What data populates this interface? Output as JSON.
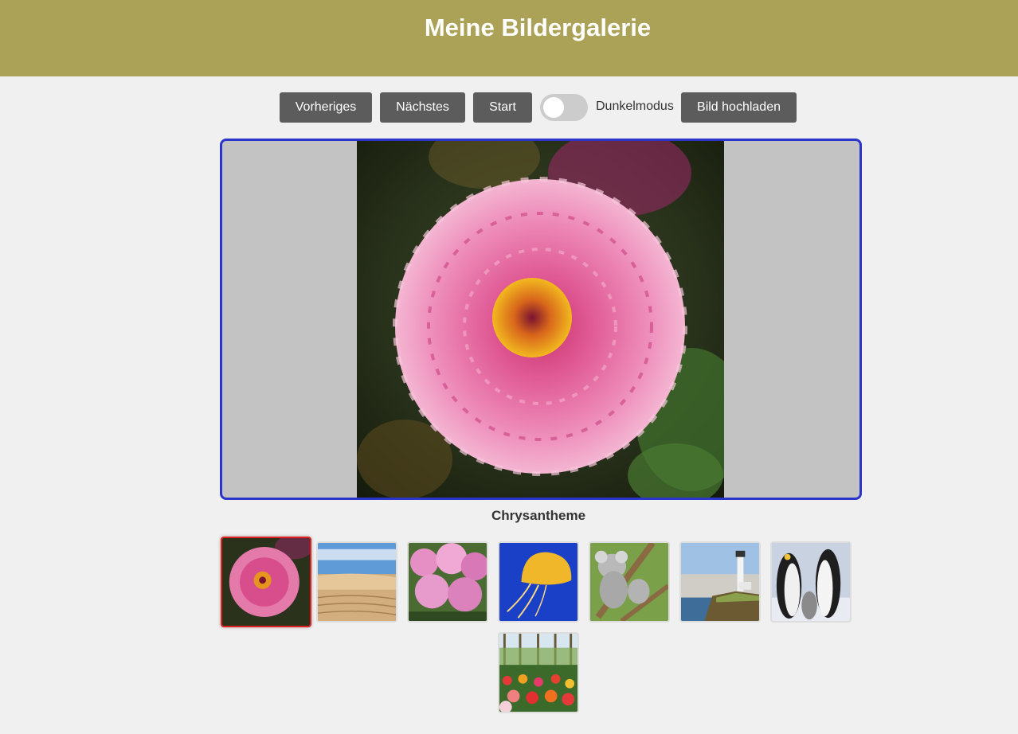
{
  "header": {
    "title": "Meine Bildergalerie"
  },
  "toolbar": {
    "prev_label": "Vorheriges",
    "next_label": "Nächstes",
    "start_label": "Start",
    "dark_mode_label": "Dunkelmodus",
    "dark_mode_on": false,
    "upload_label": "Bild hochladen"
  },
  "viewer": {
    "caption": "Chrysantheme",
    "active_index": 0
  },
  "thumbnails": [
    {
      "subject": "chrysanthemum",
      "active": true
    },
    {
      "subject": "desert"
    },
    {
      "subject": "hydrangeas"
    },
    {
      "subject": "jellyfish"
    },
    {
      "subject": "koala"
    },
    {
      "subject": "lighthouse"
    },
    {
      "subject": "penguins"
    },
    {
      "subject": "tulips"
    }
  ],
  "colors": {
    "header_bg": "#aba257",
    "button_bg": "#5c5c5c",
    "viewer_border": "#2b35c9",
    "active_thumb_border": "#e02020"
  }
}
